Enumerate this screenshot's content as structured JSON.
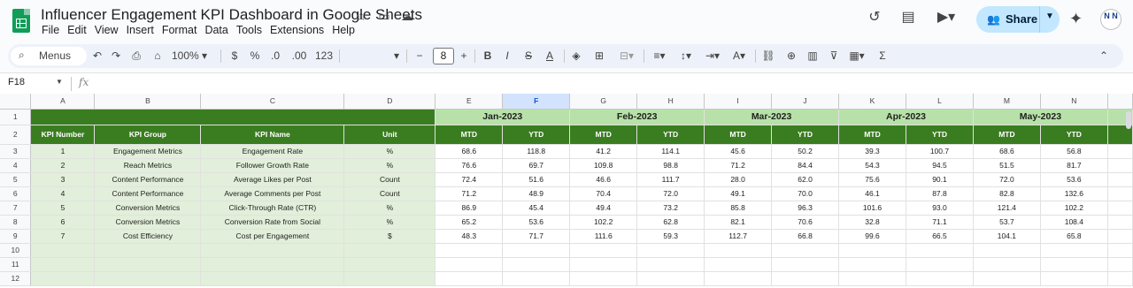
{
  "app": {
    "title": "Influencer Engagement KPI Dashboard in Google Sheets",
    "menu": [
      "File",
      "Edit",
      "View",
      "Insert",
      "Format",
      "Data",
      "Tools",
      "Extensions",
      "Help"
    ],
    "share_label": "Share",
    "avatar_text": "N N"
  },
  "toolbar": {
    "menus_label": "Menus",
    "zoom": "100%",
    "currency": "$",
    "percent": "%",
    "dec_decrease": ".0",
    "dec_increase": ".00",
    "format_123": "123",
    "font_size": "8"
  },
  "formula_bar": {
    "cell_ref": "F18",
    "fx": "fx"
  },
  "columns": [
    "A",
    "B",
    "C",
    "D",
    "E",
    "F",
    "G",
    "H",
    "I",
    "J",
    "K",
    "L",
    "M",
    "N"
  ],
  "selected_column": "F",
  "rows": [
    "1",
    "2",
    "3",
    "4",
    "5",
    "6",
    "7",
    "8",
    "9",
    "10",
    "11",
    "12"
  ],
  "months": [
    "Jan-2023",
    "Feb-2023",
    "Mar-2023",
    "Apr-2023",
    "May-2023"
  ],
  "headers": [
    "KPI Number",
    "KPI Group",
    "KPI Name",
    "Unit"
  ],
  "sub_headers": [
    "MTD",
    "YTD",
    "MTD",
    "YTD",
    "MTD",
    "YTD",
    "MTD",
    "YTD",
    "MTD",
    "YTD"
  ],
  "kpis": [
    {
      "num": "1",
      "group": "Engagement Metrics",
      "name": "Engagement Rate",
      "unit": "%",
      "values": [
        "68.6",
        "118.8",
        "41.2",
        "114.1",
        "45.6",
        "50.2",
        "39.3",
        "100.7",
        "68.6",
        "56.8"
      ]
    },
    {
      "num": "2",
      "group": "Reach Metrics",
      "name": "Follower Growth Rate",
      "unit": "%",
      "values": [
        "76.6",
        "69.7",
        "109.8",
        "98.8",
        "71.2",
        "84.4",
        "54.3",
        "94.5",
        "51.5",
        "81.7"
      ]
    },
    {
      "num": "3",
      "group": "Content Performance",
      "name": "Average Likes per Post",
      "unit": "Count",
      "values": [
        "72.4",
        "51.6",
        "46.6",
        "111.7",
        "28.0",
        "62.0",
        "75.6",
        "90.1",
        "72.0",
        "53.6"
      ]
    },
    {
      "num": "4",
      "group": "Content Performance",
      "name": "Average Comments per Post",
      "unit": "Count",
      "values": [
        "71.2",
        "48.9",
        "70.4",
        "72.0",
        "49.1",
        "70.0",
        "46.1",
        "87.8",
        "82.8",
        "132.6"
      ]
    },
    {
      "num": "5",
      "group": "Conversion Metrics",
      "name": "Click-Through Rate (CTR)",
      "unit": "%",
      "values": [
        "86.9",
        "45.4",
        "49.4",
        "73.2",
        "85.8",
        "96.3",
        "101.6",
        "93.0",
        "121.4",
        "102.2"
      ]
    },
    {
      "num": "6",
      "group": "Conversion Metrics",
      "name": "Conversion Rate from Social",
      "unit": "%",
      "values": [
        "65.2",
        "53.6",
        "102.2",
        "62.8",
        "82.1",
        "70.6",
        "32.8",
        "71.1",
        "53.7",
        "108.4"
      ]
    },
    {
      "num": "7",
      "group": "Cost Efficiency",
      "name": "Cost per Engagement",
      "unit": "$",
      "values": [
        "48.3",
        "71.7",
        "111.6",
        "59.3",
        "112.7",
        "66.8",
        "99.6",
        "66.5",
        "104.1",
        "65.8"
      ]
    }
  ],
  "colors": {
    "header_dark_green": "#3a7d20",
    "month_light_green": "#b7e1a8",
    "label_pale_green": "#e2efda",
    "share_button": "#c2e7ff",
    "sheets_logo": "#0f9d58"
  }
}
